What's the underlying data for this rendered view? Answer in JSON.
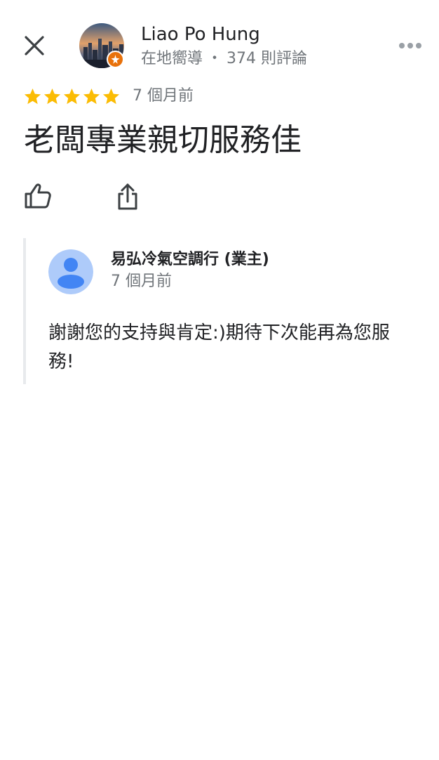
{
  "header": {
    "close_icon": "close-icon",
    "reviewer": {
      "name": "Liao Po Hung",
      "meta_role": "在地嚮導",
      "meta_separator": "・",
      "meta_reviews": "374 則評論",
      "badge_icon": "local-guide-badge-icon"
    },
    "more_icon": "more-horizontal-icon"
  },
  "review": {
    "rating": 5,
    "max_rating": 5,
    "star_color": "#fbbc04",
    "time": "7 個月前",
    "text": "老闆專業親切服務佳"
  },
  "actions": {
    "like_icon": "thumb-up-icon",
    "share_icon": "share-icon"
  },
  "owner_reply": {
    "name": "易弘冷氣空調行 (業主)",
    "time": "7 個月前",
    "text": "謝謝您的支持與肯定:)期待下次能再為您服務!",
    "avatar_color": "#aecbfa",
    "avatar_figure_color": "#4285f4"
  },
  "colors": {
    "text_primary": "#202124",
    "text_secondary": "#70757a",
    "badge": "#e8710a",
    "reply_bar": "#e8eaed"
  }
}
